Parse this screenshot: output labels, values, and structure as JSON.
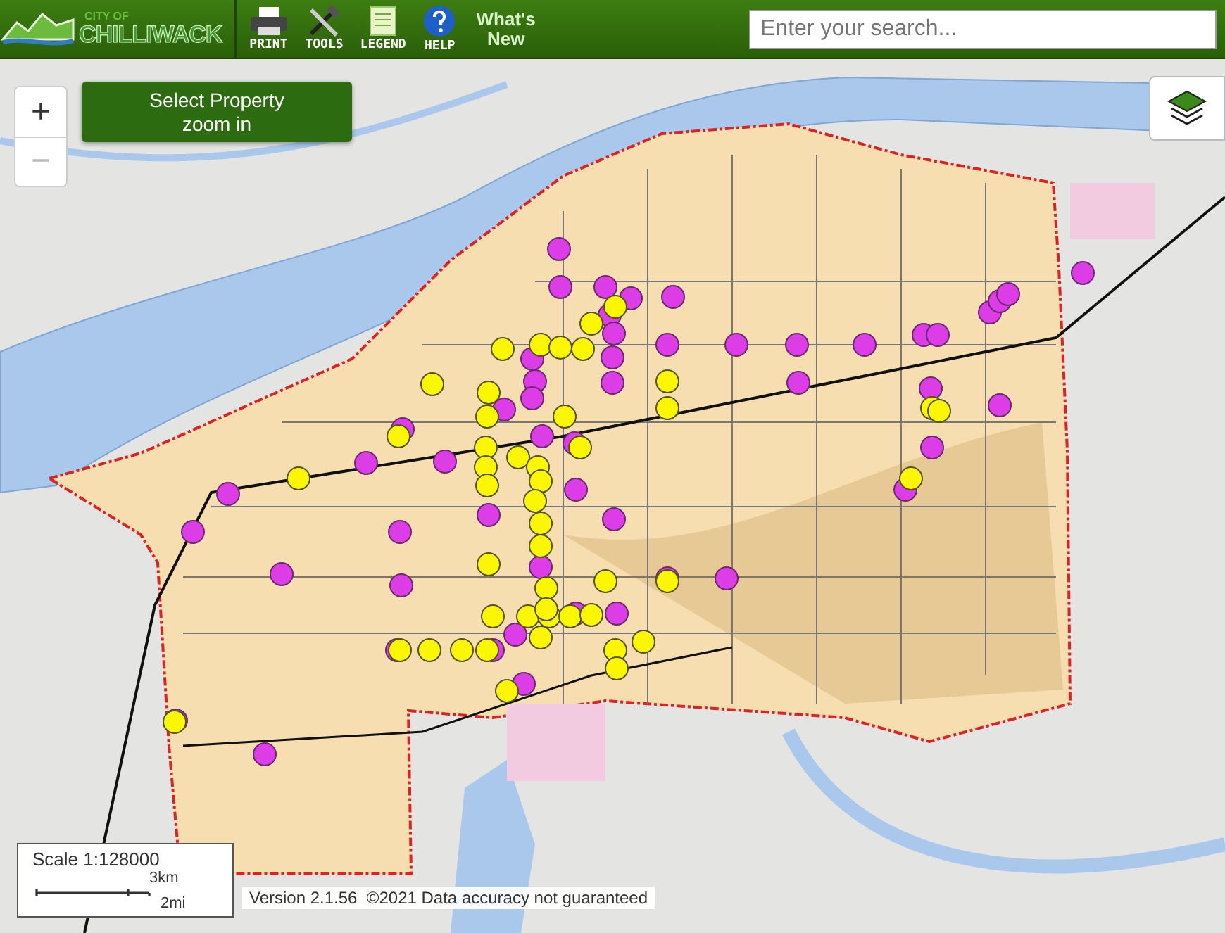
{
  "header": {
    "logo": {
      "small": "CITY OF",
      "name": "CHILLIWACK"
    },
    "tools": [
      {
        "kind": "printer",
        "label": "PRINT"
      },
      {
        "kind": "tools",
        "label": "TOOLS"
      },
      {
        "kind": "legend",
        "label": "LEGEND"
      },
      {
        "kind": "help",
        "label": "HELP"
      }
    ],
    "whats_new": "What's New",
    "search": {
      "placeholder": "Enter your search..."
    }
  },
  "map": {
    "zoom_in": {
      "label": "+",
      "disabled": false
    },
    "zoom_out": {
      "label": "−",
      "disabled": true
    },
    "select_property": {
      "line1": "Select Property",
      "line2": "zoom in"
    },
    "scale": {
      "title": "Scale 1:128000",
      "km": "3km",
      "mi": "2mi"
    },
    "footer": "Version 2.1.56  ©2021 Data accuracy not guaranteed"
  }
}
